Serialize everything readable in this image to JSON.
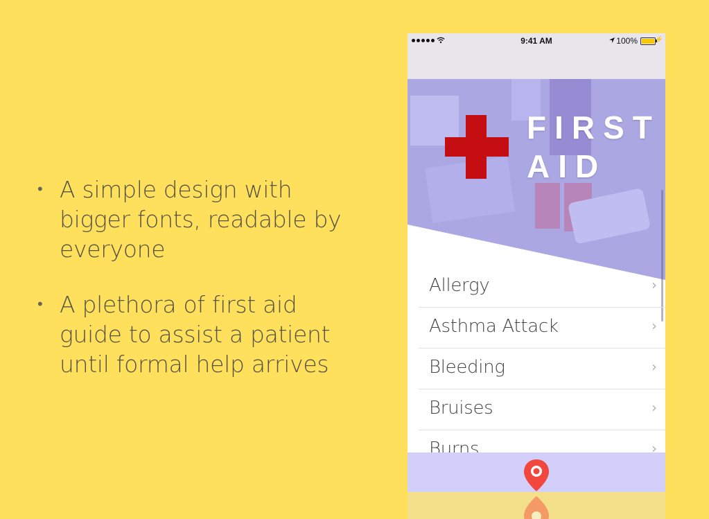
{
  "slide": {
    "bullets": [
      "A simple design with bigger fonts, readable by everyone",
      "A plethora of first aid guide to assist a patient until formal help arrives"
    ]
  },
  "status_bar": {
    "time": "9:41 AM",
    "battery": "100%"
  },
  "hero": {
    "title_line1": "FIRST",
    "title_line2": "AID"
  },
  "topics": [
    {
      "label": "Allergy"
    },
    {
      "label": "Asthma Attack"
    },
    {
      "label": "Bleeding"
    },
    {
      "label": "Bruises"
    },
    {
      "label": "Burns"
    }
  ],
  "icons": {
    "row_chevron": "chevron-right-icon",
    "bottom": "location-pin-icon"
  },
  "colors": {
    "slide_background": "#FFE05C",
    "hero_overlay": "#9E9BEF",
    "bottom_bar": "#D3CFFB",
    "cross": "#C40E12",
    "pin": "#F2473C"
  }
}
